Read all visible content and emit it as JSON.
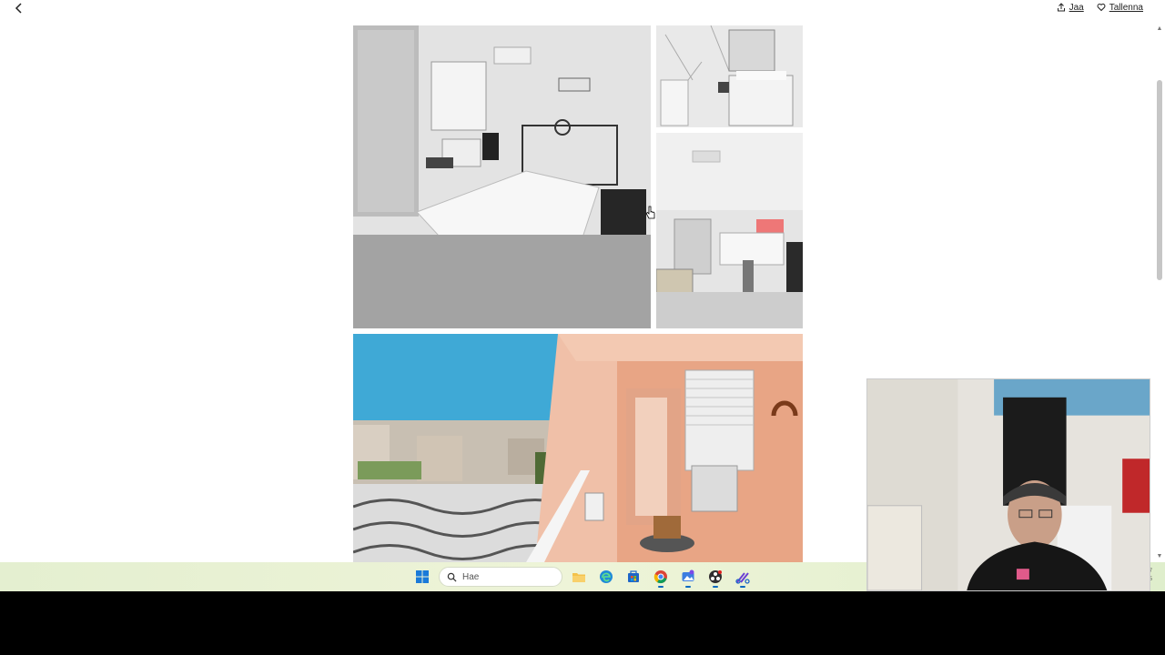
{
  "header": {
    "share_label": "Jaa",
    "save_label": "Tallenna"
  },
  "icons": {
    "back": "chevron-left-icon",
    "share": "share-icon",
    "save": "heart-icon",
    "search": "search-icon"
  },
  "taskbar": {
    "search_placeholder": "Hae",
    "apps": [
      "windows-start",
      "search",
      "file-explorer",
      "edge",
      "store",
      "chrome",
      "photos",
      "obs",
      "snipping-tool"
    ],
    "tray_text": [
      "7",
      "5"
    ]
  },
  "colors": {
    "taskbar_bg": "#e8f1d2",
    "scroll_thumb": "#c6c6c6",
    "sky": "#3fa9d6",
    "balcony_wall": "#e8a585"
  }
}
